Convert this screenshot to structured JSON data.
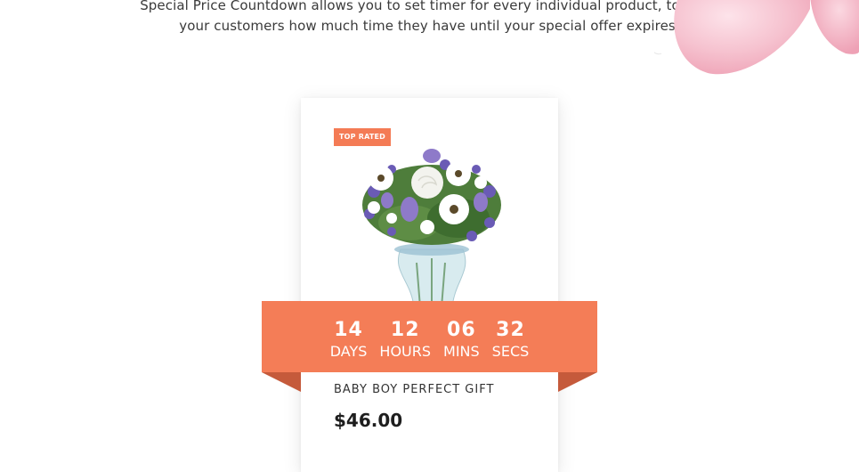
{
  "intro": {
    "line1": "Special Price Countdown allows you to set timer for every individual product, to show",
    "line2": "your customers how much time they have until your special offer expires."
  },
  "product": {
    "badge": "TOP RATED",
    "title": "BABY BOY PERFECT GIFT",
    "price": "$46.00",
    "image_icon": "flower-bouquet-in-vase"
  },
  "countdown": {
    "days": {
      "value": "14",
      "label": "DAYS"
    },
    "hours": {
      "value": "12",
      "label": "HOURS"
    },
    "mins": {
      "value": "06",
      "label": "MINS"
    },
    "secs": {
      "value": "32",
      "label": "SECS"
    }
  },
  "colors": {
    "accent": "#f47d57",
    "ribbon_fold": "#c55a3b",
    "petal": "#f6c6d2"
  }
}
